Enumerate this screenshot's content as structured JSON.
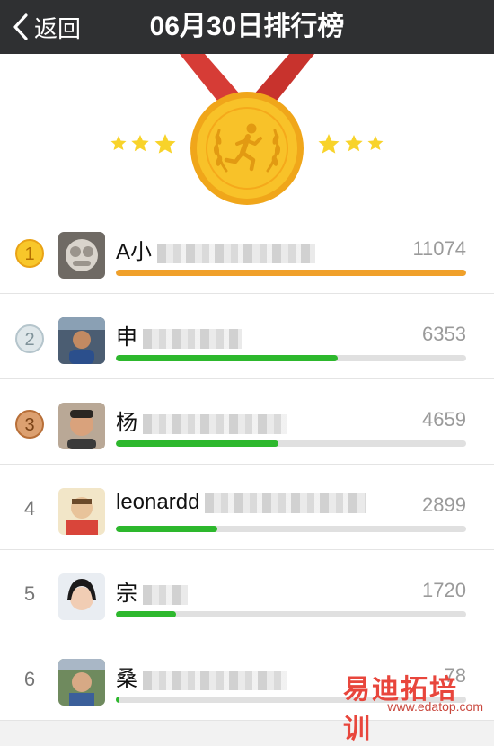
{
  "header": {
    "back_label": "返回",
    "title": "06月30日排行榜"
  },
  "hero": {
    "medal_icon": "running-man-medal",
    "colors": {
      "ribbon": "#d63c36",
      "medal": "#f8c229",
      "medal_rim": "#f0a61a",
      "stars": "#f8d32a"
    }
  },
  "ranking": [
    {
      "rank": "1",
      "badge": "gold",
      "name": "A小",
      "steps": "11074",
      "progress": 1.0
    },
    {
      "rank": "2",
      "badge": "silver",
      "name": "申",
      "steps": "6353",
      "progress": 0.634
    },
    {
      "rank": "3",
      "badge": "bronze",
      "name": "杨",
      "steps": "4659",
      "progress": 0.464
    },
    {
      "rank": "4",
      "badge": "plain",
      "name": "leonardd",
      "steps": "2899",
      "progress": 0.29
    },
    {
      "rank": "5",
      "badge": "plain",
      "name": "宗",
      "steps": "1720",
      "progress": 0.172
    },
    {
      "rank": "6",
      "badge": "plain",
      "name": "桑",
      "steps": "78",
      "progress": 0.01
    }
  ],
  "watermark": {
    "text": "易迪拓培训",
    "url": "www.edatop.com"
  }
}
